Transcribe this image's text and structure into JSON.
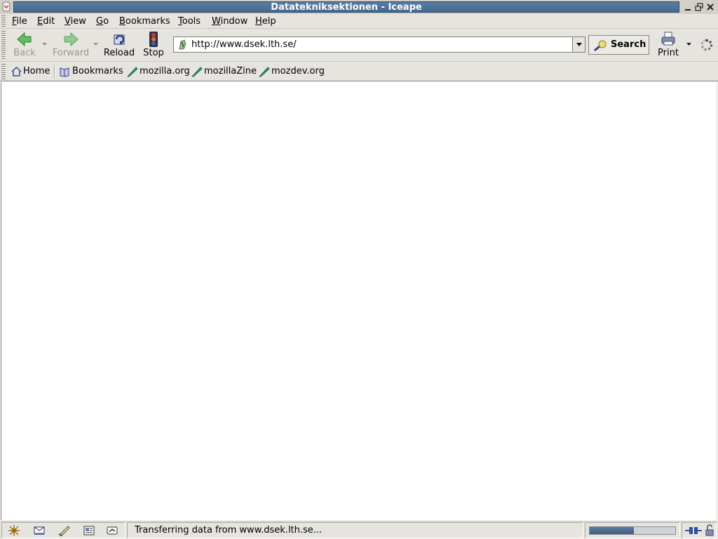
{
  "window": {
    "title": "Datatekniksektionen - Iceape"
  },
  "menubar": {
    "items": [
      {
        "label": "File",
        "accel": "F"
      },
      {
        "label": "Edit",
        "accel": "E"
      },
      {
        "label": "View",
        "accel": "V"
      },
      {
        "label": "Go",
        "accel": "G"
      },
      {
        "label": "Bookmarks",
        "accel": "B"
      },
      {
        "label": "Tools",
        "accel": "T"
      },
      {
        "label": "Window",
        "accel": "W"
      },
      {
        "label": "Help",
        "accel": "H"
      }
    ]
  },
  "navbar": {
    "back_label": "Back",
    "forward_label": "Forward",
    "reload_label": "Reload",
    "stop_label": "Stop",
    "url": "http://www.dsek.lth.se/",
    "search_label": "Search",
    "print_label": "Print",
    "back_enabled": false,
    "forward_enabled": false
  },
  "bookmarks_toolbar": {
    "home_label": "Home",
    "bookmarks_label": "Bookmarks",
    "links": [
      "mozilla.org",
      "mozillaZine",
      "mozdev.org"
    ]
  },
  "statusbar": {
    "status_text": "Transferring data from www.dsek.lth.se...",
    "progress_fraction": 0.52,
    "component_icons": [
      "navigator-icon",
      "mail-icon",
      "composer-icon",
      "addressbook-icon",
      "chatzilla-icon"
    ]
  },
  "colors": {
    "titlebar": "#4f7399",
    "chrome": "#e6e4df",
    "progress": "#46698f"
  }
}
